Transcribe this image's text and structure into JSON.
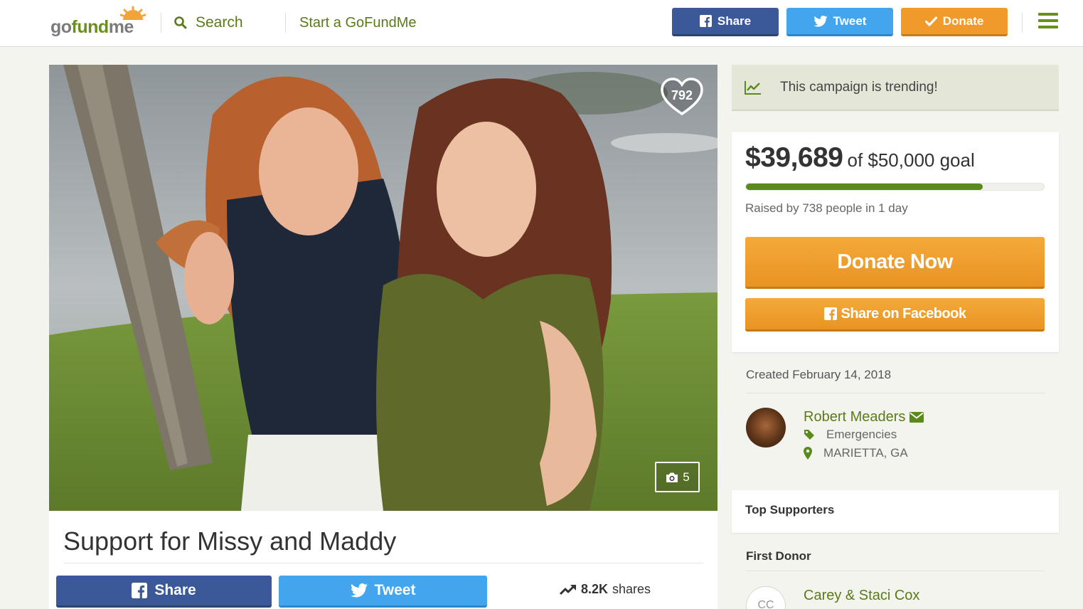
{
  "header": {
    "logo": {
      "go": "go",
      "fund": "fund",
      "me": "me"
    },
    "search_label": "Search",
    "start_label": "Start a GoFundMe",
    "share_label": "Share",
    "tweet_label": "Tweet",
    "donate_label": "Donate"
  },
  "campaign": {
    "title": "Support for Missy and Maddy",
    "hearts": "792",
    "photo_count": "5",
    "share_label": "Share",
    "tweet_label": "Tweet",
    "shares_count": "8.2K",
    "shares_label": "shares"
  },
  "sidebar": {
    "trending_text": "This campaign is trending!",
    "raised_amount": "$39,689",
    "goal_text": "of $50,000 goal",
    "progress_fraction": 0.794,
    "raised_by": "Raised by 738 people in 1 day",
    "donate_now_label": "Donate Now",
    "share_facebook_label": "Share on Facebook",
    "created": "Created February 14, 2018",
    "organizer_name": "Robert Meaders",
    "category": "Emergencies",
    "location": "MARIETTA, GA",
    "top_supporters_label": "Top Supporters",
    "first_donor_label": "First Donor",
    "first_donor_initials": "CC",
    "first_donor_name": "Carey & Staci Cox"
  },
  "colors": {
    "brand_green": "#5b7a1c",
    "facebook_blue": "#3b5998",
    "twitter_blue": "#42a5ee",
    "donate_orange": "#ef9a2a"
  },
  "icons": [
    "search-icon",
    "facebook-icon",
    "twitter-icon",
    "check-icon",
    "menu-icon",
    "heart-icon",
    "camera-icon",
    "trending-icon",
    "envelope-icon",
    "tag-icon",
    "map-pin-icon"
  ]
}
